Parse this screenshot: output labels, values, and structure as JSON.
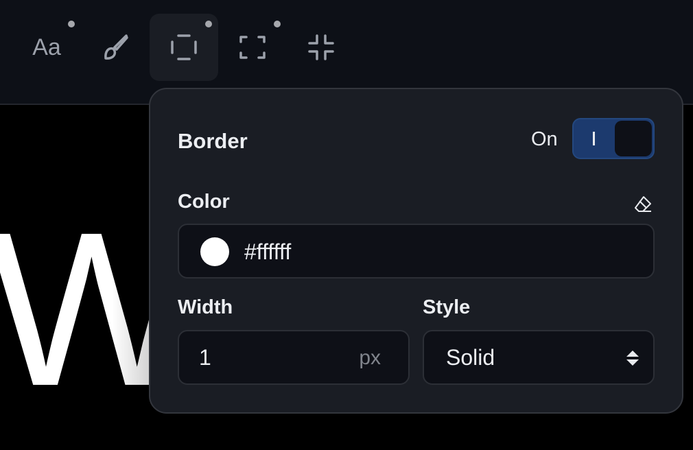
{
  "toolbar": {
    "tools": [
      {
        "name": "typography",
        "icon": "text-aa-icon",
        "modified": true,
        "active": false
      },
      {
        "name": "fill",
        "icon": "paintbrush-icon",
        "modified": false,
        "active": false
      },
      {
        "name": "border",
        "icon": "border-icon",
        "modified": true,
        "active": true
      },
      {
        "name": "padding",
        "icon": "corners-expand-icon",
        "modified": true,
        "active": false
      },
      {
        "name": "margin",
        "icon": "corners-collapse-icon",
        "modified": false,
        "active": false
      }
    ],
    "text_tool_label": "Aa"
  },
  "canvas": {
    "text": "W"
  },
  "border_panel": {
    "title": "Border",
    "toggle_label": "On",
    "enabled": true,
    "color_label": "Color",
    "color_value": "#ffffff",
    "clear_icon": "eraser-icon",
    "width_label": "Width",
    "width_value": "1",
    "width_unit": "px",
    "style_label": "Style",
    "style_value": "Solid",
    "accent": "#1c3a6e"
  }
}
